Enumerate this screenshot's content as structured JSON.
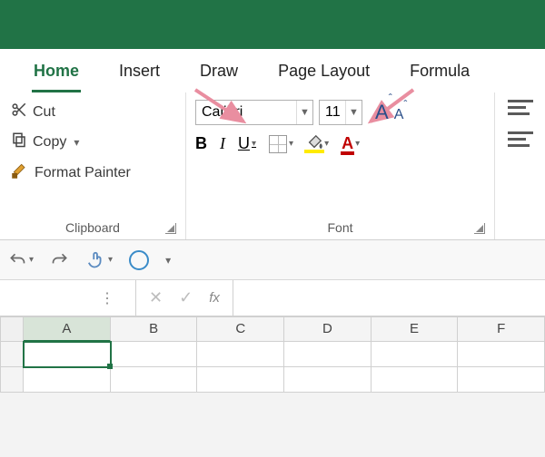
{
  "tabs": {
    "home": "Home",
    "insert": "Insert",
    "draw": "Draw",
    "pagelayout": "Page Layout",
    "formulas": "Formula"
  },
  "clipboard": {
    "cut": "Cut",
    "copy": "Copy",
    "formatpainter": "Format Painter",
    "group_label": "Clipboard"
  },
  "font": {
    "name_value": "Calibri",
    "size_value": "11",
    "bold": "B",
    "italic": "I",
    "underline": "U",
    "group_label": "Font",
    "fontcolor_letter": "A",
    "grow_letter": "A",
    "shrink_letter": "A"
  },
  "formula_bar": {
    "namebox_value": "",
    "fx_label": "fx",
    "cancel": "✕",
    "enter": "✓",
    "formula_value": ""
  },
  "columns": [
    "A",
    "B",
    "C",
    "D",
    "E",
    "F"
  ],
  "icons": {
    "cut": "scissors",
    "copy": "copy-pages",
    "formatpainter": "paintbrush",
    "undo": "undo-arrow",
    "redo": "redo-arrow",
    "touch": "touch-finger",
    "circle": "circle",
    "customize": "down-caret"
  },
  "annotation_arrows": {
    "color": "#e98ea0",
    "targets": [
      "font-name-combo",
      "font-size-combo"
    ]
  }
}
